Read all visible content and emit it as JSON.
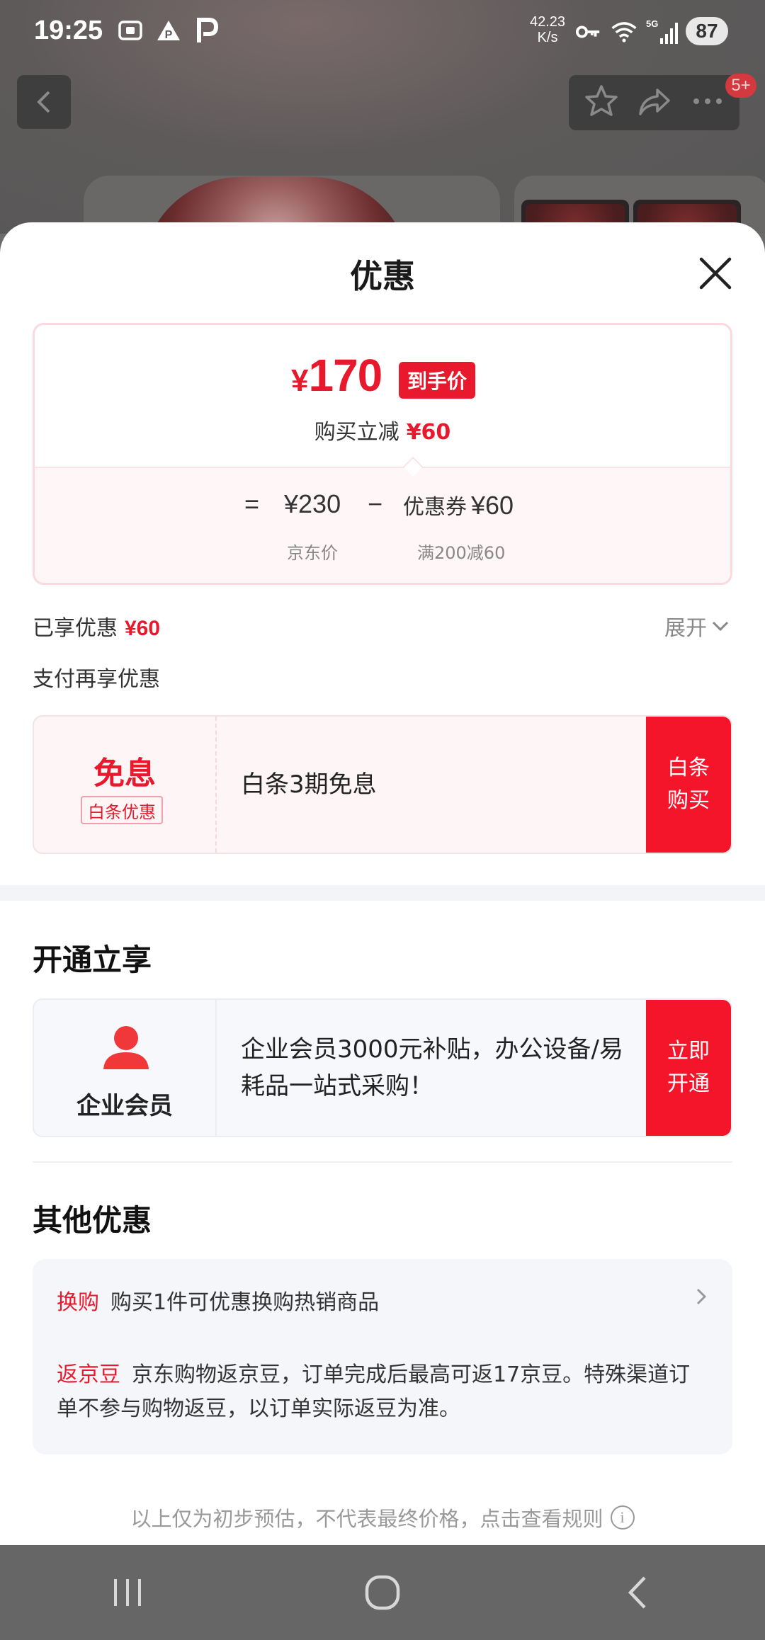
{
  "status_bar": {
    "time": "19:25",
    "net_speed_value": "42.23",
    "net_speed_unit": "K/s",
    "network": "5G",
    "battery": "87",
    "icons": [
      "screenshot-icon",
      "alert-icon",
      "parking-icon",
      "key-icon",
      "wifi-icon",
      "signal-icon"
    ]
  },
  "top_bar": {
    "message_badge": "5+",
    "icons": [
      "back-arrow-icon",
      "star-icon",
      "share-icon",
      "more-icon"
    ]
  },
  "sheet": {
    "title": "优惠",
    "price_card": {
      "currency": "¥",
      "final_price": "170",
      "final_price_tag": "到手价",
      "instant_off_label": "购买立减",
      "instant_off_amount": "¥60",
      "formula": {
        "equals": "=",
        "jd_price": "¥230",
        "minus": "−",
        "coupon_label": "优惠券",
        "coupon_amount": "¥60",
        "jd_price_caption": "京东价",
        "coupon_caption": "满200减60"
      }
    },
    "enjoyed": {
      "label": "已享优惠",
      "amount": "¥60",
      "expand_label": "展开"
    },
    "pay_more_label": "支付再享优惠",
    "baitiao_offer": {
      "title": "免息",
      "tag": "白条优惠",
      "description": "白条3期免息",
      "button_line1": "白条",
      "button_line2": "购买"
    },
    "open_section": {
      "title": "开通立享",
      "member_name": "企业会员",
      "description": "企业会员3000元补贴，办公设备/易耗品一站式采购！",
      "button_line1": "立即",
      "button_line2": "开通"
    },
    "other_section": {
      "title": "其他优惠",
      "swap_tag": "换购",
      "swap_text": "购买1件可优惠换购热销商品",
      "bean_tag": "返京豆",
      "bean_text": "京东购物返京豆，订单完成后最高可返17京豆。特殊渠道订单不参与购物返豆，以订单实际返豆为准。"
    },
    "disclaimer": "以上仅为初步预估，不代表最终价格，点击查看规则"
  },
  "colors": {
    "accent_red": "#e8192c",
    "button_red": "#f5152b",
    "muted_text": "#888888"
  },
  "nav_bar": {
    "icons": [
      "recents-icon",
      "home-icon",
      "back-icon"
    ]
  }
}
